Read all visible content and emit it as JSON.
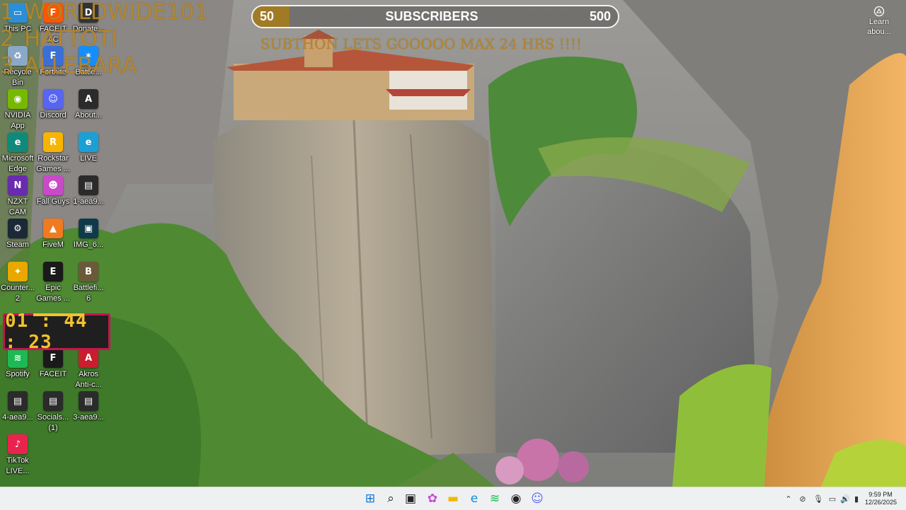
{
  "leaderboard": [
    {
      "rank": "1",
      "name": "WORLDWIDE101"
    },
    {
      "rank": "2",
      "name": "HATTOTI"
    },
    {
      "rank": "3",
      "name": "ALLEBARA"
    }
  ],
  "subscriber_goal": {
    "current": "50",
    "label": "SUBSCRIBERS",
    "goal": "500",
    "progress_fraction": 0.1,
    "fill_color": "#a07a25"
  },
  "sub_message": "SUBTHON LETS GOOOOO MAX 24 HRS  !!!!",
  "timer": "01 : 44 : 23",
  "learn_about": {
    "label": "Learn\nabou...",
    "icon": "camera-icon"
  },
  "desktop_icons": [
    {
      "label": "This PC",
      "icon": "monitor-icon",
      "color": "#2a8fd8",
      "glyph": "▭"
    },
    {
      "label": "FACEIT\nAC",
      "icon": "faceit-icon",
      "color": "#ff5500",
      "glyph": "F"
    },
    {
      "label": "Donate...",
      "icon": "donate-icon",
      "color": "#333333",
      "glyph": "D"
    },
    {
      "label": "Recycle\nBin",
      "icon": "recycle-bin-icon",
      "color": "#8aa8c8",
      "glyph": "♻"
    },
    {
      "label": "Fortnite",
      "icon": "fortnite-icon",
      "color": "#3a6fd8",
      "glyph": "F"
    },
    {
      "label": "Battle...",
      "icon": "battlenet-icon",
      "color": "#148eff",
      "glyph": "✶"
    },
    {
      "label": "NVIDIA\nApp",
      "icon": "nvidia-icon",
      "color": "#76b900",
      "glyph": "◉"
    },
    {
      "label": "Discord",
      "icon": "discord-icon",
      "color": "#5865f2",
      "glyph": "☺"
    },
    {
      "label": "About...",
      "icon": "about-icon",
      "color": "#2b2b2b",
      "glyph": "A"
    },
    {
      "label": "Microsoft\nEdge",
      "icon": "edge-icon",
      "color": "#0f8a7a",
      "glyph": "e"
    },
    {
      "label": "Rockstar\nGames ...",
      "icon": "rockstar-icon",
      "color": "#f7b500",
      "glyph": "R"
    },
    {
      "label": "LIVE",
      "icon": "live-edge-icon",
      "color": "#1a9fd6",
      "glyph": "e"
    },
    {
      "label": "NZXT\nCAM",
      "icon": "nzxt-cam-icon",
      "color": "#6a2bb0",
      "glyph": "N"
    },
    {
      "label": "Fall Guys",
      "icon": "fall-guys-icon",
      "color": "#c84ac8",
      "glyph": "☻"
    },
    {
      "label": "1-aea9...",
      "icon": "image-file-icon",
      "color": "#2b2b2b",
      "glyph": "▤"
    },
    {
      "label": "Steam",
      "icon": "steam-icon",
      "color": "#1b2838",
      "glyph": "⚙"
    },
    {
      "label": "FiveM",
      "icon": "fivem-icon",
      "color": "#f07a20",
      "glyph": "▲"
    },
    {
      "label": "IMG_6...",
      "icon": "image-file-icon",
      "color": "#0f3a4a",
      "glyph": "▣"
    },
    {
      "label": "Counter...\n2",
      "icon": "counter-strike-icon",
      "color": "#e8a800",
      "glyph": "✦"
    },
    {
      "label": "Epic\nGames ...",
      "icon": "epic-games-icon",
      "color": "#1a1a1a",
      "glyph": "E"
    },
    {
      "label": "Battlefi...\n6",
      "icon": "battlefield-icon",
      "color": "#6a5a3a",
      "glyph": "B"
    },
    {
      "label": "Spotify",
      "icon": "spotify-icon",
      "color": "#1db954",
      "glyph": "≋"
    },
    {
      "label": "FACEIT",
      "icon": "faceit-icon",
      "color": "#1a1a1a",
      "glyph": "F"
    },
    {
      "label": "Akros\nAnti-c...",
      "icon": "akros-icon",
      "color": "#c81e2e",
      "glyph": "A"
    },
    {
      "label": "4-aea9...",
      "icon": "image-file-icon",
      "color": "#2b2b2b",
      "glyph": "▤"
    },
    {
      "label": "Socials...\n(1)",
      "icon": "image-file-icon",
      "color": "#2b2b2b",
      "glyph": "▤"
    },
    {
      "label": "3-aea9...",
      "icon": "image-file-icon",
      "color": "#2b2b2b",
      "glyph": "▤"
    },
    {
      "label": "TikTok\nLIVE...",
      "icon": "tiktok-live-icon",
      "color": "#e8244e",
      "glyph": "♪"
    }
  ],
  "taskbar": {
    "apps": [
      {
        "icon": "windows-start-icon",
        "color": "#0a74da",
        "glyph": "⊞"
      },
      {
        "icon": "search-icon",
        "color": "#222222",
        "glyph": "⌕"
      },
      {
        "icon": "task-view-icon",
        "color": "#222222",
        "glyph": "▣"
      },
      {
        "icon": "copilot-icon",
        "color": "#c84ad8",
        "glyph": "✿"
      },
      {
        "icon": "file-explorer-icon",
        "color": "#f2b800",
        "glyph": "▬"
      },
      {
        "icon": "edge-icon",
        "color": "#0f8ad8",
        "glyph": "e"
      },
      {
        "icon": "spotify-icon",
        "color": "#1db954",
        "glyph": "≋"
      },
      {
        "icon": "obs-icon",
        "color": "#222222",
        "glyph": "◉"
      },
      {
        "icon": "discord-icon",
        "color": "#5865f2",
        "glyph": "☺"
      }
    ],
    "tray": [
      {
        "icon": "chevron-up-icon",
        "glyph": "⌃"
      },
      {
        "icon": "network-off-icon",
        "glyph": "⊘"
      },
      {
        "icon": "microphone-icon",
        "glyph": "🎙"
      },
      {
        "icon": "display-icon",
        "glyph": "▭"
      },
      {
        "icon": "volume-icon",
        "glyph": "🔊"
      },
      {
        "icon": "battery-icon",
        "glyph": "▮"
      }
    ],
    "time": "9:59 PM",
    "date": "12/26/2025"
  }
}
